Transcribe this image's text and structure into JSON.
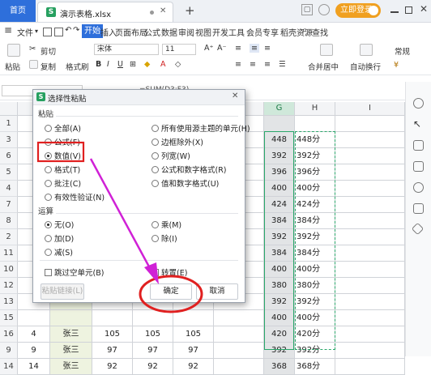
{
  "titlebar": {
    "home_tab": "首页",
    "file_tab": "演示表格.xlsx",
    "file_icon": "S",
    "login_label": "立即登录"
  },
  "menu": {
    "items": [
      "文件",
      "开始",
      "插入",
      "页面布局",
      "公式",
      "数据",
      "审阅",
      "视图",
      "开发工具",
      "会员专享",
      "稻壳资源"
    ],
    "search": "查找"
  },
  "ribbon": {
    "paste": "粘贴",
    "cut": "剪切",
    "copy": "复制",
    "format_painter": "格式刷",
    "font_name": "宋体",
    "font_size": "11",
    "merge_center": "合并居中",
    "wrap_text": "自动换行",
    "number_format": "常规"
  },
  "formula": {
    "content": "=SUM(D3:F3)"
  },
  "grid": {
    "col_headers": [
      "G",
      "H",
      "I"
    ],
    "row_numbers": [
      "1",
      "3",
      "6",
      "5",
      "4",
      "7",
      "8",
      "2",
      "11",
      "10",
      "12",
      "13",
      "15",
      "16",
      "9",
      "14"
    ],
    "g_values": [
      "",
      "448",
      "392",
      "396",
      "400",
      "424",
      "384",
      "392",
      "384",
      "400",
      "380",
      "392",
      "400",
      "420",
      "392",
      "368"
    ],
    "h_values": [
      "",
      "448分",
      "392分",
      "396分",
      "400分",
      "424分",
      "384分",
      "392分",
      "384分",
      "400分",
      "380分",
      "392分",
      "400分",
      "420分",
      "392分",
      "368分"
    ],
    "bottom_rows": [
      {
        "a": "4",
        "b": "张三",
        "d": "105",
        "e": "105",
        "f": "105"
      },
      {
        "a": "9",
        "b": "张三",
        "d": "97",
        "e": "97",
        "f": "97"
      },
      {
        "a": "14",
        "b": "张三",
        "d": "92",
        "e": "92",
        "f": "92"
      }
    ]
  },
  "dialog": {
    "title": "选择性粘贴",
    "paste_section": "粘贴",
    "paste_left": [
      "全部(A)",
      "公式(F)",
      "数值(V)",
      "格式(T)",
      "批注(C)",
      "有效性验证(N)"
    ],
    "paste_right": [
      "所有使用源主题的单元(H)",
      "边框除外(X)",
      "列宽(W)",
      "公式和数字格式(R)",
      "值和数字格式(U)"
    ],
    "operation_section": "运算",
    "op_left": [
      "无(O)",
      "加(D)",
      "减(S)"
    ],
    "op_right": [
      "乘(M)",
      "除(I)"
    ],
    "skip_blanks": "跳过空单元(B)",
    "transpose": "转置(E)",
    "paste_link": "粘贴链接(L)",
    "ok": "确定",
    "cancel": "取消"
  },
  "colors": {
    "accent": "#2e6fdb",
    "selection_green": "#2aa76a",
    "annotation_red": "#e02020",
    "arrow_magenta": "#d021d6"
  }
}
